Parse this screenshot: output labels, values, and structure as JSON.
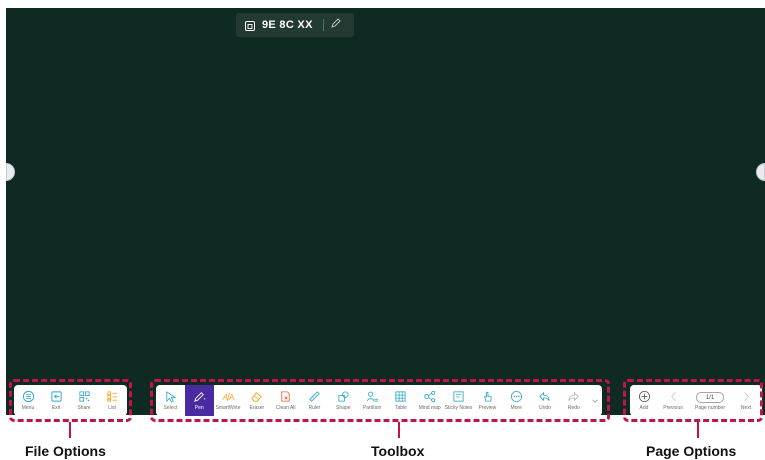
{
  "board": {
    "title": "9E 8C XX",
    "background": "#0f2a22"
  },
  "file_options": {
    "items": [
      {
        "label": "Menu"
      },
      {
        "label": "Exit"
      },
      {
        "label": "Share"
      },
      {
        "label": "List"
      }
    ]
  },
  "toolbox": {
    "items": [
      {
        "label": "Select"
      },
      {
        "label": "Pen"
      },
      {
        "label": "SmartWrite"
      },
      {
        "label": "Eraser"
      },
      {
        "label": "Clean All"
      },
      {
        "label": "Ruler"
      },
      {
        "label": "Shape"
      },
      {
        "label": "Partition"
      },
      {
        "label": "Table"
      },
      {
        "label": "Mind map"
      },
      {
        "label": "Sticky Notes"
      },
      {
        "label": "Preview"
      },
      {
        "label": "More"
      },
      {
        "label": "Undo"
      },
      {
        "label": "Redo"
      }
    ]
  },
  "page_options": {
    "add_label": "Add",
    "previous_label": "Previous",
    "page_indicator": "1/1",
    "page_number_label": "Page number",
    "next_label": "Next"
  },
  "callouts": {
    "file_options": "File Options",
    "toolbox": "Toolbox",
    "page_options": "Page Options"
  },
  "colors": {
    "accent": "#4a2aa0",
    "callout_dash": "#c0144a",
    "icon_orange": "#f5a623",
    "icon_teal": "#2aa7c9"
  }
}
